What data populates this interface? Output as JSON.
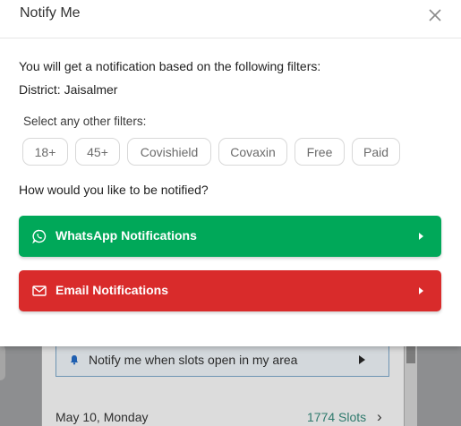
{
  "modal": {
    "title": "Notify Me",
    "intro": "You will get a notification based on the following filters:",
    "district_label": "District:",
    "district_value": "Jaisalmer",
    "filters_label": "Select any other filters:",
    "filters": [
      "18+",
      "45+",
      "Covishield",
      "Covaxin",
      "Free",
      "Paid"
    ],
    "question": "How would you like to be notified?",
    "whatsapp_label": "WhatsApp Notifications",
    "email_label": "Email Notifications"
  },
  "background": {
    "notify_text": "Notify me when slots open in my area",
    "date": "May 10, Monday",
    "slots": "1774 Slots"
  },
  "colors": {
    "whatsapp": "#00a859",
    "email": "#d92b2b",
    "slots": "#2f7a6d"
  },
  "icons": {
    "close": "close-icon",
    "whatsapp": "whatsapp-icon",
    "email": "mail-icon",
    "bell": "bell-icon"
  }
}
